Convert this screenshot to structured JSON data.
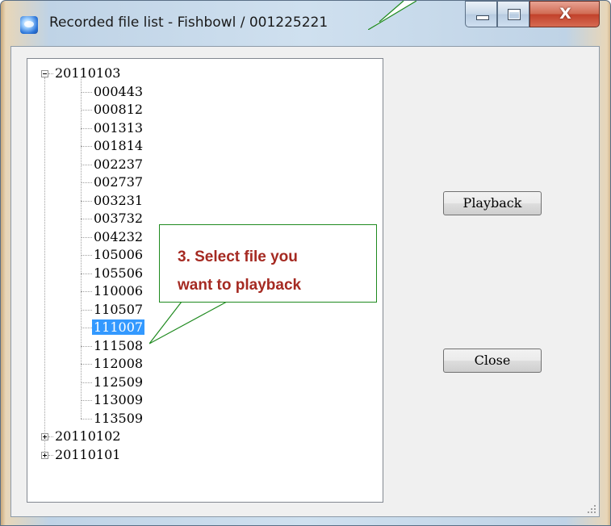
{
  "window": {
    "title": "Recorded file list - Fishbowl / 001225221",
    "controls": {
      "minimize_icon": "minimize-icon",
      "maximize_icon": "maximize-icon",
      "close_glyph": "X"
    }
  },
  "tree": {
    "root_nodes": [
      {
        "label": "20110103",
        "expanded": true,
        "children": [
          "000443",
          "000812",
          "001313",
          "001814",
          "002237",
          "002737",
          "003231",
          "003732",
          "004232",
          "105006",
          "105506",
          "110006",
          "110507",
          "111007",
          "111508",
          "112008",
          "112509",
          "113009",
          "113509"
        ]
      },
      {
        "label": "20110102",
        "expanded": false
      },
      {
        "label": "20110101",
        "expanded": false
      }
    ],
    "selected": "111007"
  },
  "buttons": {
    "playback": "Playback",
    "close": "Close"
  },
  "callout": {
    "line1": "3. Select file you",
    "line2": "want to playback"
  },
  "colors": {
    "selection": "#3399ff",
    "callout_text": "#a52a22",
    "callout_border": "#1f8a1f"
  }
}
